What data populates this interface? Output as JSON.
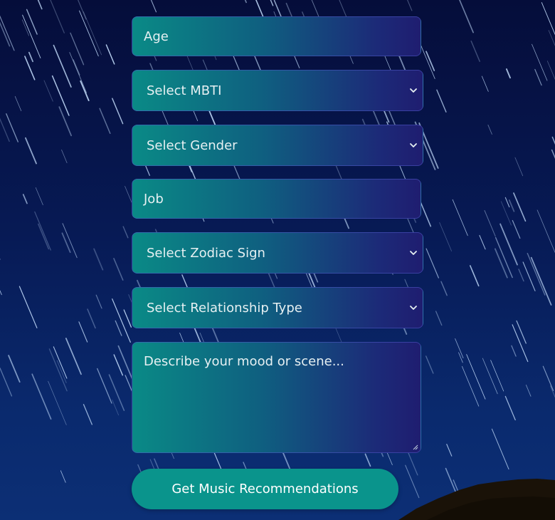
{
  "form": {
    "age": {
      "placeholder": "Age"
    },
    "mbti": {
      "selected": "Select MBTI"
    },
    "gender": {
      "selected": "Select Gender"
    },
    "job": {
      "placeholder": "Job"
    },
    "zodiac": {
      "selected": "Select Zodiac Sign"
    },
    "relationship": {
      "selected": "Select Relationship Type"
    },
    "mood": {
      "placeholder": "Describe your mood or scene..."
    },
    "submit_label": "Get Music Recommendations"
  },
  "colors": {
    "background": "#071a55",
    "field_start": "#0a8a86",
    "field_end": "#1f1d70",
    "button": "#0a948c",
    "text": "#e6f0f2"
  },
  "icons": {
    "dropdown": "chevron-down-icon",
    "resize": "resize-grip-icon"
  }
}
